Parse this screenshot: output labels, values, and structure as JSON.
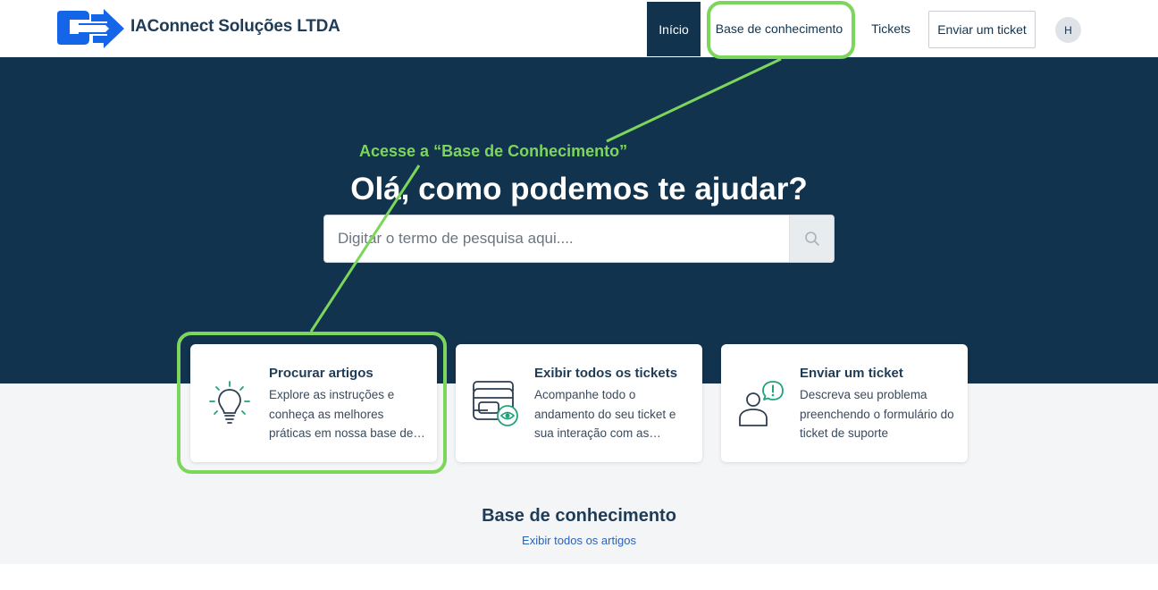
{
  "header": {
    "brand": "IAConnect Soluções LTDA",
    "nav": {
      "home": "Início",
      "knowledge_base": "Base de conhecimento",
      "tickets": "Tickets",
      "send_ticket": "Enviar um ticket"
    },
    "avatar_initial": "H"
  },
  "hero": {
    "title": "Olá, como podemos te ajudar?",
    "search_placeholder": "Digitar o termo de pesquisa aqui...."
  },
  "cards": [
    {
      "title": "Procurar artigos",
      "description": "Explore as instruções e conheça as melhores práticas em nossa base de conhecimento",
      "icon": "lightbulb-icon"
    },
    {
      "title": "Exibir todos os tickets",
      "description": "Acompanhe todo o andamento do seu ticket e sua interação com as equipes",
      "icon": "tickets-eye-icon"
    },
    {
      "title": "Enviar um ticket",
      "description": "Descreva seu problema preenchendo o formulário do ticket de suporte",
      "icon": "person-alert-icon"
    }
  ],
  "knowledge_base": {
    "heading": "Base de conhecimento",
    "link": "Exibir todos os artigos"
  },
  "annotation": {
    "text": "Acesse a “Base de Conhecimento”",
    "color": "#7dd65c"
  },
  "colors": {
    "navy": "#12334d",
    "accent_green": "#1fa37a",
    "logo_blue": "#1565e8",
    "link_blue": "#2b63b8"
  }
}
